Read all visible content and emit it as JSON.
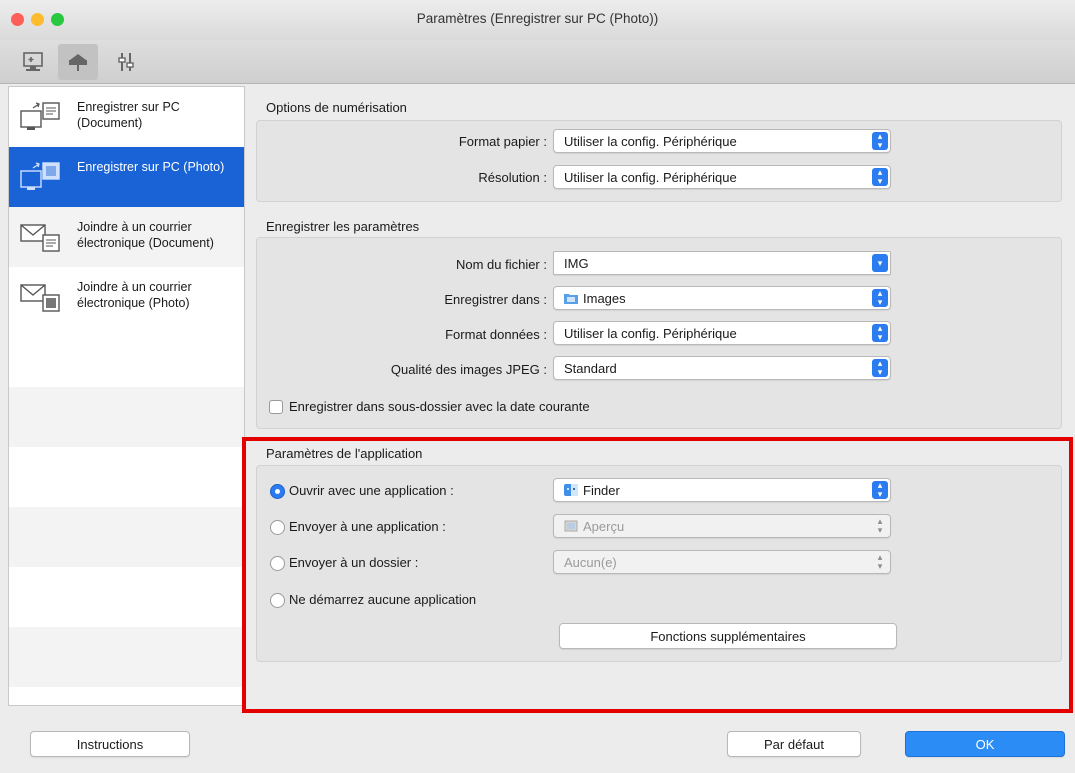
{
  "window": {
    "title": "Paramètres (Enregistrer sur PC (Photo))"
  },
  "toolbar": {
    "tabs": [
      {
        "icon": "computer-scan-icon"
      },
      {
        "icon": "scanner-icon"
      },
      {
        "icon": "general-settings-icon"
      }
    ]
  },
  "sidebar": {
    "items": [
      {
        "label": "Enregistrer sur PC (Document)",
        "icon": "save-pc-document-icon"
      },
      {
        "label": "Enregistrer sur PC (Photo)",
        "icon": "save-pc-photo-icon"
      },
      {
        "label": "Joindre à un courrier électronique (Document)",
        "icon": "email-document-icon"
      },
      {
        "label": "Joindre à un courrier électronique (Photo)",
        "icon": "email-photo-icon"
      }
    ]
  },
  "scan_options": {
    "title": "Options de numérisation",
    "paper_size_label": "Format papier :",
    "paper_size_value": "Utiliser la config. Périphérique",
    "resolution_label": "Résolution :",
    "resolution_value": "Utiliser la config. Périphérique"
  },
  "save_settings": {
    "title": "Enregistrer les paramètres",
    "file_name_label": "Nom du fichier :",
    "file_name_value": "IMG",
    "save_in_label": "Enregistrer dans :",
    "save_in_value": "Images",
    "data_format_label": "Format données :",
    "data_format_value": "Utiliser la config. Périphérique",
    "jpeg_quality_label": "Qualité des images JPEG :",
    "jpeg_quality_value": "Standard",
    "subfolder_label": "Enregistrer dans sous-dossier avec la date courante"
  },
  "app_settings": {
    "title": "Paramètres de l'application",
    "open_with_label": "Ouvrir avec une application :",
    "open_with_value": "Finder",
    "send_to_app_label": "Envoyer à une application :",
    "send_to_app_value": "Aperçu",
    "send_to_folder_label": "Envoyer à un dossier :",
    "send_to_folder_value": "Aucun(e)",
    "no_app_label": "Ne démarrez aucune application",
    "more_functions_label": "Fonctions supplémentaires"
  },
  "footer": {
    "instructions_label": "Instructions",
    "defaults_label": "Par défaut",
    "ok_label": "OK"
  },
  "colors": {
    "accent": "#1a63d6",
    "highlight": "#e40000"
  }
}
